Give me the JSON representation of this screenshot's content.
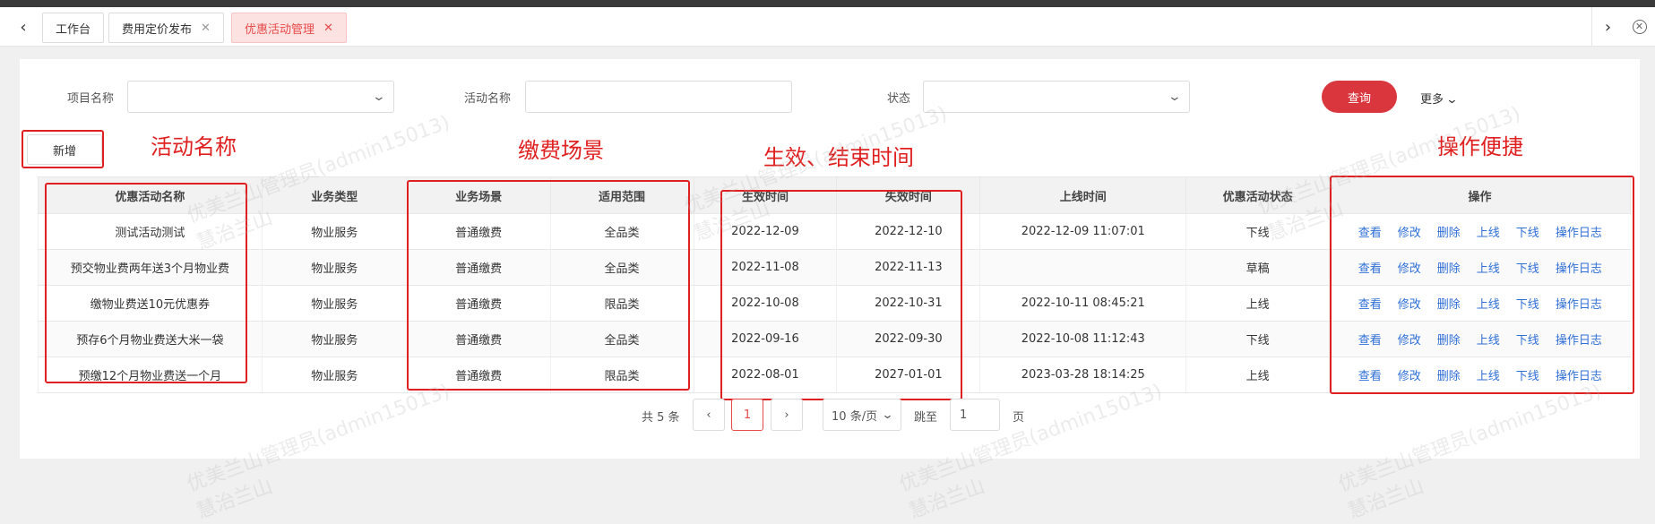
{
  "tabs": [
    {
      "label": "工作台",
      "closable": false,
      "active": false
    },
    {
      "label": "费用定价发布",
      "closable": true,
      "active": false
    },
    {
      "label": "优惠活动管理",
      "closable": true,
      "active": true
    }
  ],
  "filters": {
    "project_label": "项目名称",
    "activity_label": "活动名称",
    "status_label": "状态",
    "query_button": "查询",
    "more_label": "更多"
  },
  "add_button": "新增",
  "annotations": {
    "activity_name": "活动名称",
    "payment_scene": "缴费场景",
    "effective_time": "生效、结束时间",
    "operation": "操作便捷"
  },
  "table": {
    "headers": [
      "优惠活动名称",
      "业务类型",
      "业务场景",
      "适用范围",
      "生效时间",
      "失效时间",
      "上线时间",
      "优惠活动状态",
      "操作"
    ],
    "rows": [
      [
        "测试活动测试",
        "物业服务",
        "普通缴费",
        "全品类",
        "2022-12-09",
        "2022-12-10",
        "2022-12-09 11:07:01",
        "下线"
      ],
      [
        "预交物业费两年送3个月物业费",
        "物业服务",
        "普通缴费",
        "全品类",
        "2022-11-08",
        "2022-11-13",
        "",
        "草稿"
      ],
      [
        "缴物业费送10元优惠券",
        "物业服务",
        "普通缴费",
        "限品类",
        "2022-10-08",
        "2022-10-31",
        "2022-10-11 08:45:21",
        "上线"
      ],
      [
        "预存6个月物业费送大米一袋",
        "物业服务",
        "普通缴费",
        "全品类",
        "2022-09-16",
        "2022-09-30",
        "2022-10-08 11:12:43",
        "下线"
      ],
      [
        "预缴12个月物业费送一个月",
        "物业服务",
        "普通缴费",
        "限品类",
        "2022-08-01",
        "2027-01-01",
        "2023-03-28 18:14:25",
        "上线"
      ]
    ],
    "actions": [
      "查看",
      "修改",
      "删除",
      "上线",
      "下线",
      "操作日志"
    ]
  },
  "pagination": {
    "total_text": "共 5 条",
    "current_page": "1",
    "page_size": "10 条/页",
    "goto_label": "跳至",
    "goto_value": "1",
    "page_suffix": "页"
  },
  "watermark": {
    "line1": "优美兰山管理员(admin15013)",
    "line2": "慧治兰山"
  },
  "colors": {
    "accent": "#d9363e",
    "link": "#2f6fd6",
    "annotation": "#e02020"
  }
}
